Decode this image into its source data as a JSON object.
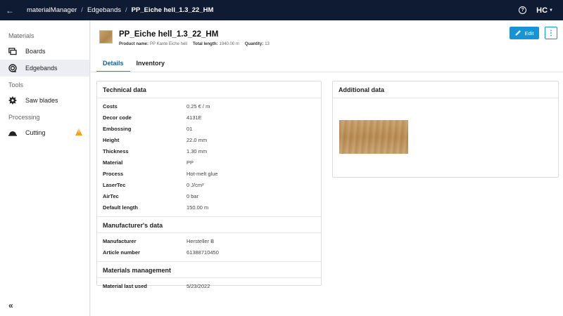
{
  "topbar": {
    "back_icon": "arrow-left-icon",
    "breadcrumb": [
      "materialManager",
      "Edgebands",
      "PP_Eiche hell_1.3_22_HM"
    ],
    "help_icon": "help-icon",
    "logo_text": "HC"
  },
  "sidebar": {
    "sections": [
      {
        "label": "Materials",
        "items": [
          {
            "label": "Boards",
            "icon": "board-icon"
          },
          {
            "label": "Edgebands",
            "icon": "edgeband-icon",
            "active": true
          }
        ]
      },
      {
        "label": "Tools",
        "items": [
          {
            "label": "Saw blades",
            "icon": "saw-blade-icon"
          }
        ]
      },
      {
        "label": "Processing",
        "items": [
          {
            "label": "Cutting",
            "icon": "cutting-icon",
            "warning": true
          }
        ]
      }
    ],
    "collapse_icon": "double-chevron-left-icon"
  },
  "header": {
    "title": "PP_Eiche hell_1.3_22_HM",
    "meta": [
      {
        "label": "Product name:",
        "value": "PP Kante Eiche hell"
      },
      {
        "label": "Total length:",
        "value": "1940.00 m"
      },
      {
        "label": "Quantity:",
        "value": "13"
      }
    ],
    "edit_label": "Edit"
  },
  "tabs": [
    "Details",
    "Inventory"
  ],
  "technical": {
    "title": "Technical data",
    "rows": [
      {
        "k": "Costs",
        "v": "0.25 € / m"
      },
      {
        "k": "Decor code",
        "v": "4131E"
      },
      {
        "k": "Embossing",
        "v": "01"
      },
      {
        "k": "Height",
        "v": "22.0 mm"
      },
      {
        "k": "Thickness",
        "v": "1.30 mm"
      },
      {
        "k": "Material",
        "v": "PP"
      },
      {
        "k": "Process",
        "v": "Hot-melt glue"
      },
      {
        "k": "LaserTec",
        "v": "0 J/cm²"
      },
      {
        "k": "AirTec",
        "v": "0 bar"
      },
      {
        "k": "Default length",
        "v": "150.00 m"
      }
    ]
  },
  "manufacturer": {
    "title": "Manufacturer's data",
    "rows": [
      {
        "k": "Manufacturer",
        "v": "Hersteller B"
      },
      {
        "k": "Article number",
        "v": "61388710450"
      }
    ]
  },
  "management": {
    "title": "Materials management",
    "rows": [
      {
        "k": "Material last used",
        "v": "5/23/2022"
      }
    ]
  },
  "additional": {
    "title": "Additional data"
  },
  "colors": {
    "topbar": "#0f1b33",
    "accent": "#1a93d6",
    "warning": "#f5a01a"
  }
}
